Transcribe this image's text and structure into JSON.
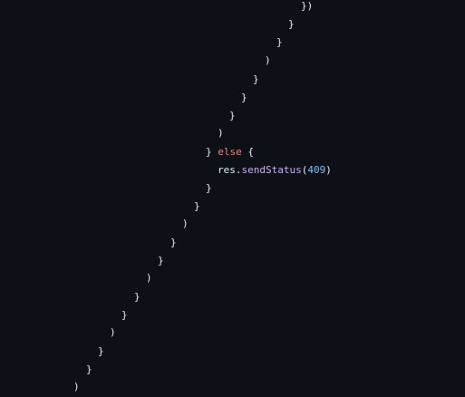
{
  "code": {
    "lines": [
      {
        "tokens": [
          {
            "t": "})",
            "c": "punc"
          }
        ]
      },
      {
        "tokens": [
          {
            "t": "}",
            "c": "punc"
          }
        ]
      },
      {
        "tokens": [
          {
            "t": "}",
            "c": "punc"
          }
        ]
      },
      {
        "tokens": [
          {
            "t": ")",
            "c": "punc"
          }
        ]
      },
      {
        "tokens": [
          {
            "t": "}",
            "c": "punc"
          }
        ]
      },
      {
        "tokens": [
          {
            "t": "}",
            "c": "punc"
          }
        ]
      },
      {
        "tokens": [
          {
            "t": "}",
            "c": "punc"
          }
        ]
      },
      {
        "tokens": [
          {
            "t": ")",
            "c": "punc"
          }
        ]
      },
      {
        "tokens": [
          {
            "t": "} ",
            "c": "punc"
          },
          {
            "t": "else",
            "c": "kw"
          },
          {
            "t": " {",
            "c": "punc"
          }
        ]
      },
      {
        "tokens": [
          {
            "t": "res.",
            "c": "plain"
          },
          {
            "t": "sendStatus",
            "c": "fn"
          },
          {
            "t": "(",
            "c": "punc"
          },
          {
            "t": "409",
            "c": "num"
          },
          {
            "t": ")",
            "c": "punc"
          }
        ]
      },
      {
        "tokens": [
          {
            "t": "}",
            "c": "punc"
          }
        ]
      },
      {
        "tokens": [
          {
            "t": "}",
            "c": "punc"
          }
        ]
      },
      {
        "tokens": [
          {
            "t": ")",
            "c": "punc"
          }
        ]
      },
      {
        "tokens": [
          {
            "t": "}",
            "c": "punc"
          }
        ]
      },
      {
        "tokens": [
          {
            "t": "}",
            "c": "punc"
          }
        ]
      },
      {
        "tokens": [
          {
            "t": ")",
            "c": "punc"
          }
        ]
      },
      {
        "tokens": [
          {
            "t": "}",
            "c": "punc"
          }
        ]
      },
      {
        "tokens": [
          {
            "t": "}",
            "c": "punc"
          }
        ]
      },
      {
        "tokens": [
          {
            "t": ")",
            "c": "punc"
          }
        ]
      },
      {
        "tokens": [
          {
            "t": "}",
            "c": "punc"
          }
        ]
      },
      {
        "tokens": [
          {
            "t": "}",
            "c": "punc"
          }
        ]
      },
      {
        "tokens": [
          {
            "t": ")",
            "c": "punc"
          }
        ]
      }
    ]
  },
  "colors": {
    "background": "#0d1117",
    "punctuation": "#e6edf3",
    "keyword": "#ff7b72",
    "function": "#d2a8ff",
    "number": "#79c0ff"
  }
}
